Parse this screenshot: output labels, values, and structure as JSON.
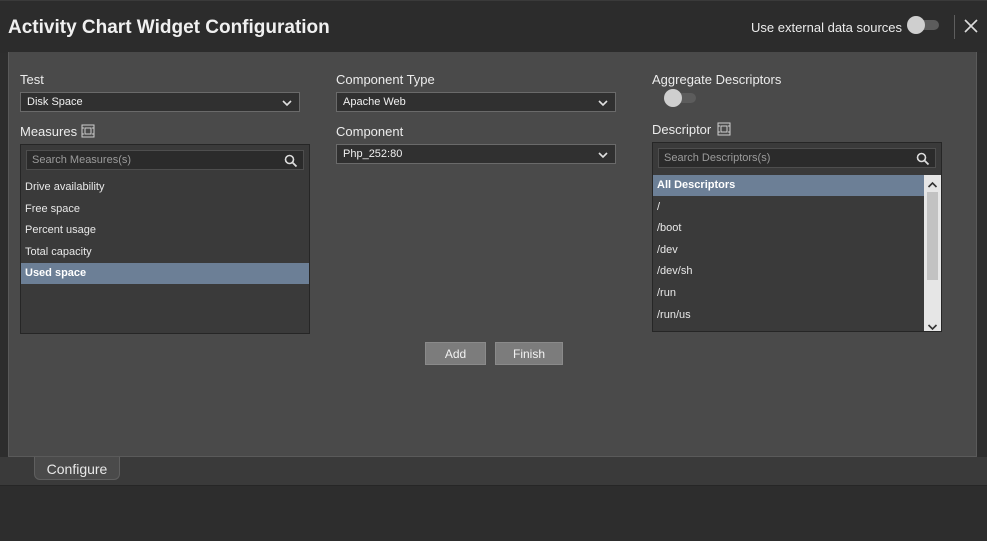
{
  "header": {
    "title": "Activity Chart Widget Configuration",
    "external_sources_label": "Use external data sources",
    "external_sources_enabled": false
  },
  "left": {
    "test_label": "Test",
    "test_value": "Disk Space",
    "measures_label": "Measures",
    "measures_search_placeholder": "Search Measures(s)",
    "measures": [
      "Drive availability",
      "Free space",
      "Percent usage",
      "Total capacity",
      "Used space"
    ],
    "selected_measure": "Used space"
  },
  "middle": {
    "component_type_label": "Component Type",
    "component_type_value": "Apache Web",
    "component_label": "Component",
    "component_value": "Php_252:80"
  },
  "right": {
    "aggregate_label": "Aggregate Descriptors",
    "aggregate_enabled": false,
    "descriptor_label": "Descriptor",
    "descriptor_search_placeholder": "Search Descriptors(s)",
    "descriptors": [
      "All Descriptors",
      "/",
      "/boot",
      "/dev",
      "/dev/sh",
      "/run",
      "/run/us"
    ],
    "selected_descriptor": "All Descriptors"
  },
  "actions": {
    "add_label": "Add",
    "finish_label": "Finish"
  },
  "tabs": {
    "configure_label": "Configure"
  },
  "colors": {
    "selection": "#6c7f96",
    "panel": "#4a4a4a",
    "header": "#2c2c2c"
  }
}
